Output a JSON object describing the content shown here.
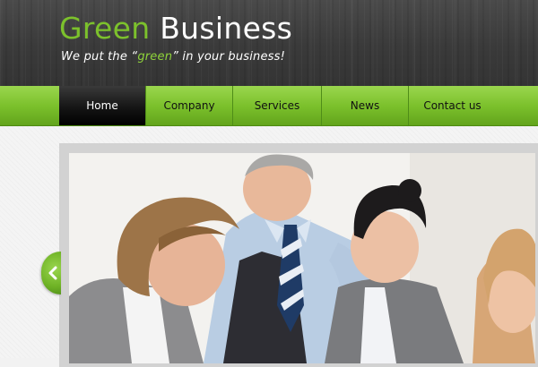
{
  "header": {
    "logo_part1": "Green",
    "logo_part2": "Business",
    "tagline_before": "We put the “",
    "tagline_highlight": "green",
    "tagline_after": "” in your business!"
  },
  "nav": {
    "items": [
      {
        "label": "Home",
        "active": true
      },
      {
        "label": "Company",
        "active": false
      },
      {
        "label": "Services",
        "active": false
      },
      {
        "label": "News",
        "active": false
      },
      {
        "label": "Contact us",
        "active": false
      }
    ]
  },
  "slider": {
    "prev_icon": "chevron-left-icon"
  },
  "colors": {
    "brand_green": "#7cc12c",
    "header_dark": "#3a3a3a",
    "active_tab": "#111111"
  }
}
